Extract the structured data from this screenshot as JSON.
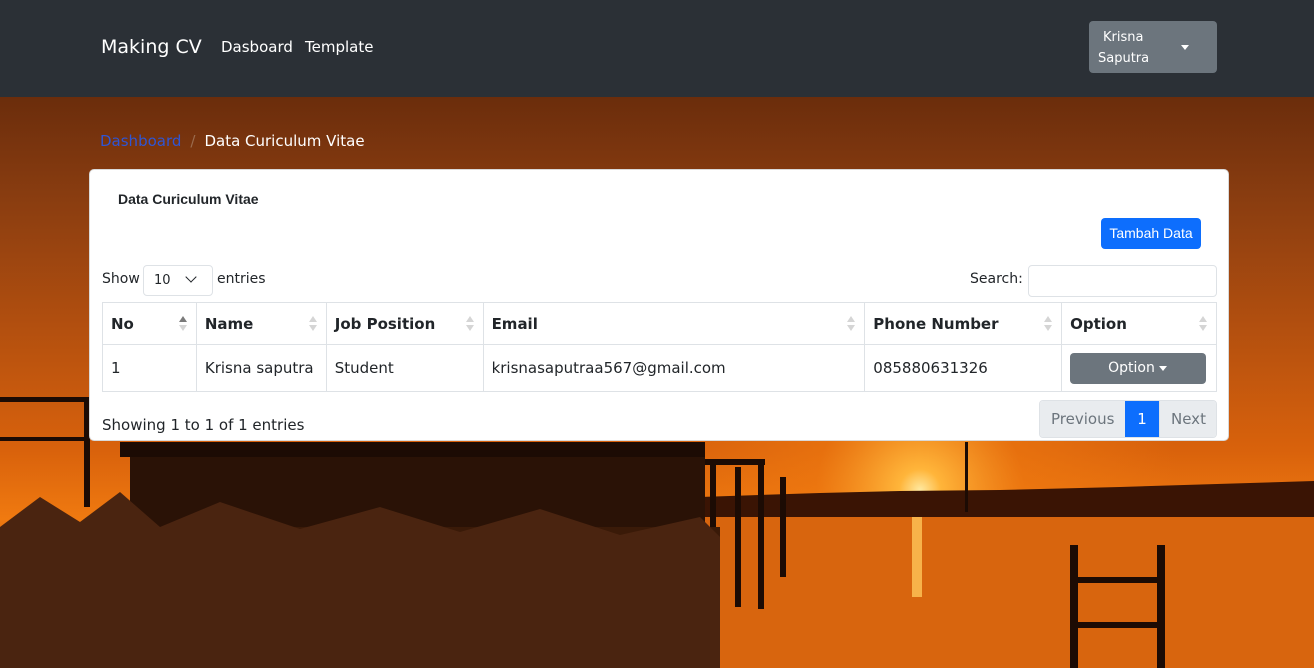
{
  "navbar": {
    "brand": "Making CV",
    "links": [
      "Dasboard",
      "Template"
    ],
    "user_first": "Krisna",
    "user_last": "Saputra"
  },
  "breadcrumb": {
    "home": "Dashboard",
    "separator": "/",
    "current": "Data Curiculum Vitae"
  },
  "card": {
    "title": "Data Curiculum Vitae",
    "add_button": "Tambah Data",
    "show_label": "Show",
    "length_value": "10",
    "entries_label": "entries",
    "search_label": "Search:",
    "search_value": ""
  },
  "table": {
    "columns": [
      "No",
      "Name",
      "Job Position",
      "Email",
      "Phone Number",
      "Option"
    ],
    "sort_column": "No",
    "sort_direction": "asc",
    "rows": [
      {
        "no": "1",
        "name": "Krisna saputra",
        "job": "Student",
        "email": "krisnasaputraa567@gmail.com",
        "phone": "085880631326",
        "option": "Option"
      }
    ]
  },
  "footer": {
    "info": "Showing 1 to 1 of 1 entries",
    "previous": "Previous",
    "current_page": "1",
    "next": "Next"
  },
  "colors": {
    "navbar": "#2b3036",
    "primary": "#0d6efd",
    "secondary": "#6c757d"
  }
}
